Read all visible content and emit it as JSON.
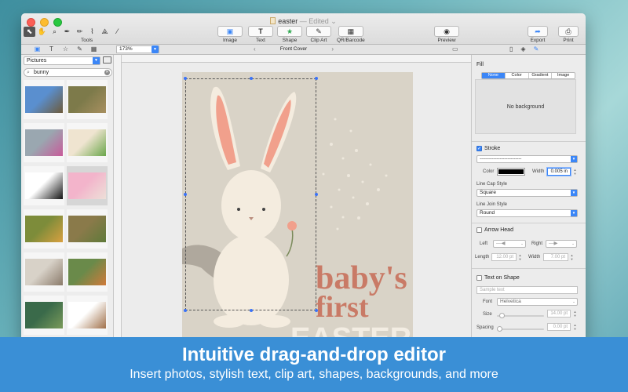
{
  "window": {
    "doc_title": "easter",
    "edited_text": "— Edited",
    "chevron": "⌄"
  },
  "toolbar": {
    "tools_label": "Tools",
    "tool_icons": [
      "select-arrow-icon",
      "hand-icon",
      "zoom-icon",
      "pen-icon",
      "pencil-icon",
      "bezier-icon",
      "polygon-icon",
      "line-icon"
    ],
    "buttons": [
      {
        "label": "Image",
        "glyph": "▣"
      },
      {
        "label": "Text",
        "glyph": "T"
      },
      {
        "label": "Shape",
        "glyph": "★"
      },
      {
        "label": "Clip Art",
        "glyph": "✎"
      },
      {
        "label": "QR/Barcode",
        "glyph": "▦"
      },
      {
        "label": "Preview",
        "glyph": "◉"
      },
      {
        "label": "Export",
        "glyph": "➦"
      },
      {
        "label": "Print",
        "glyph": "⎙"
      }
    ]
  },
  "subbar": {
    "zoom_value": "173%",
    "page_name": "Front Cover",
    "prev_arrow": "‹",
    "next_arrow": "›"
  },
  "left_panel": {
    "source": "Pictures",
    "search_value": "bunny",
    "thumbnails": [
      {
        "name": "thumb-kids-bunny-ears",
        "c1": "#5a8fcf",
        "c2": "#6d5a3a"
      },
      {
        "name": "thumb-rabbit-grass",
        "c1": "#7d7a4a",
        "c2": "#a89060"
      },
      {
        "name": "thumb-plush-eggs",
        "c1": "#9aa7b0",
        "c2": "#c85a9a"
      },
      {
        "name": "thumb-bunny-figurine",
        "c1": "#efe4d0",
        "c2": "#6aa64a"
      },
      {
        "name": "thumb-bunny-silhouette",
        "c1": "#ffffff",
        "c2": "#111111"
      },
      {
        "name": "thumb-pink-bunny-card",
        "c1": "#f3b4cb",
        "c2": "#ede0d8"
      },
      {
        "name": "thumb-bunny-flowers",
        "c1": "#7d8c3a",
        "c2": "#d9a040"
      },
      {
        "name": "thumb-rabbit-field",
        "c1": "#8a7a4a",
        "c2": "#5f7a3a"
      },
      {
        "name": "thumb-two-rabbits",
        "c1": "#d8d2c8",
        "c2": "#8a7a6a"
      },
      {
        "name": "thumb-plush-toys",
        "c1": "#6a8a4a",
        "c2": "#d07a3a"
      },
      {
        "name": "thumb-rabbit-moss",
        "c1": "#3a6a4a",
        "c2": "#7a9a5a"
      },
      {
        "name": "thumb-vintage-bunny",
        "c1": "#ffffff",
        "c2": "#a0704a"
      }
    ]
  },
  "canvas": {
    "line1": "baby's",
    "line2": "first",
    "line3": "EASTER",
    "colors": {
      "page": "#d9d3c7",
      "text": "#c97a66",
      "text2": "#f3ede3",
      "bunny": "#f4ecdf",
      "ear": "#f1a08c"
    }
  },
  "inspector": {
    "fill_title": "Fill",
    "fill_tabs": [
      "None",
      "Color",
      "Gradient",
      "Image"
    ],
    "fill_active": "None",
    "no_background": "No background",
    "stroke_title": "Stroke",
    "stroke_checked": true,
    "color_label": "Color",
    "width_label": "Width",
    "width_value": "0.005 in",
    "line_cap_label": "Line Cap Style",
    "line_cap_value": "Square",
    "line_join_label": "Line Join Style",
    "line_join_value": "Round",
    "arrow_title": "Arrow Head",
    "left_label": "Left",
    "right_label": "Right",
    "length_label": "Length",
    "length_value": "12.00 pt",
    "arrow_width_label": "Width",
    "arrow_width_value": "7.00 pt",
    "text_on_shape_title": "Text on Shape",
    "sample_placeholder": "Sample text",
    "font_label": "Font",
    "font_value": "Helvetica",
    "size_label": "Size",
    "size_value": "14.00 pt",
    "spacing_label": "Spacing",
    "spacing_value": "0.00 pt"
  },
  "banner": {
    "headline": "Intuitive drag-and-drop editor",
    "subline": "Insert photos, stylish text, clip art, shapes, backgrounds, and more",
    "color": "#3a8fd6"
  }
}
